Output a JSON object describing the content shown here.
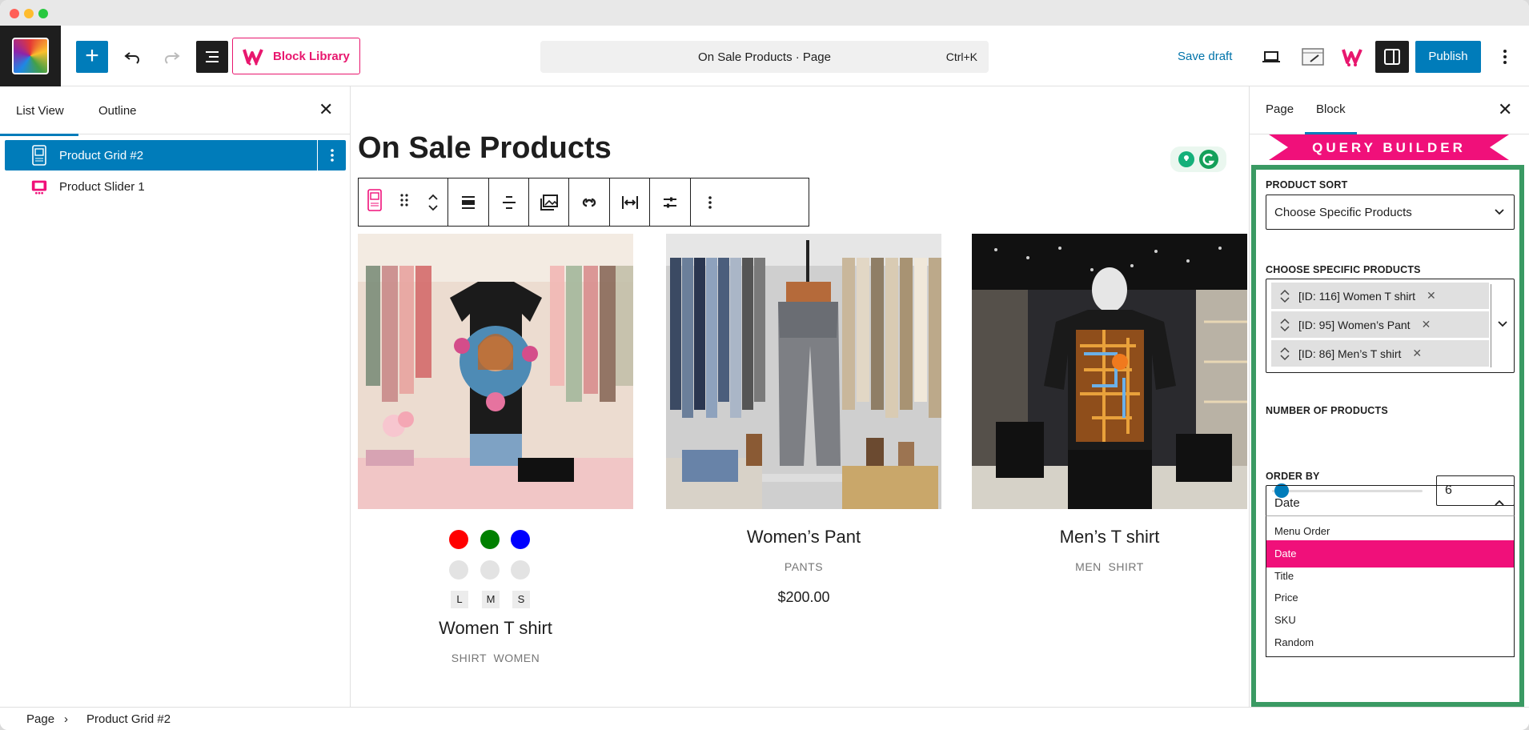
{
  "topbar": {
    "block_library_label": "Block Library",
    "command_title": "On Sale Products · Page",
    "command_shortcut": "Ctrl+K",
    "save_draft_label": "Save draft",
    "publish_label": "Publish"
  },
  "left_panel": {
    "tabs": [
      "List View",
      "Outline"
    ],
    "items": [
      {
        "label": "Product Grid #2",
        "selected": true
      },
      {
        "label": "Product Slider 1",
        "selected": false
      }
    ]
  },
  "canvas": {
    "page_title": "On Sale Products",
    "products": [
      {
        "name": "Women T shirt",
        "category": "SHIRT  WOMEN",
        "price": "",
        "swatches": [
          "#ff0000",
          "#008000",
          "#0000ff"
        ],
        "sizes": [
          "L",
          "M",
          "S"
        ]
      },
      {
        "name": "Women’s Pant",
        "category": "PANTS",
        "price": "$200.00"
      },
      {
        "name": "Men’s T shirt",
        "category": "MEN  SHIRT",
        "price": ""
      }
    ]
  },
  "right_panel": {
    "tabs": [
      "Page",
      "Block"
    ],
    "banner": "QUERY BUILDER",
    "product_sort": {
      "label": "PRODUCT SORT",
      "value": "Choose Specific Products"
    },
    "choose_specific": {
      "label": "CHOOSE SPECIFIC PRODUCTS",
      "chips": [
        "[ID: 116] Women T shirt",
        "[ID: 95] Women’s Pant",
        "[ID: 86] Men’s T shirt"
      ]
    },
    "number_of_products": {
      "label": "NUMBER OF PRODUCTS",
      "value": "6",
      "slider_fraction": 0.05
    },
    "order_by": {
      "label": "ORDER BY",
      "value": "Date",
      "options": [
        "Menu Order",
        "Date",
        "Title",
        "Price",
        "SKU",
        "Random"
      ],
      "selected_index": 1
    }
  },
  "footer": {
    "crumbs": [
      "Page",
      "Product Grid #2"
    ]
  },
  "colors": {
    "accent": "#007cba",
    "brand_pink": "#f0107a",
    "settings_border": "#3a9a63"
  }
}
